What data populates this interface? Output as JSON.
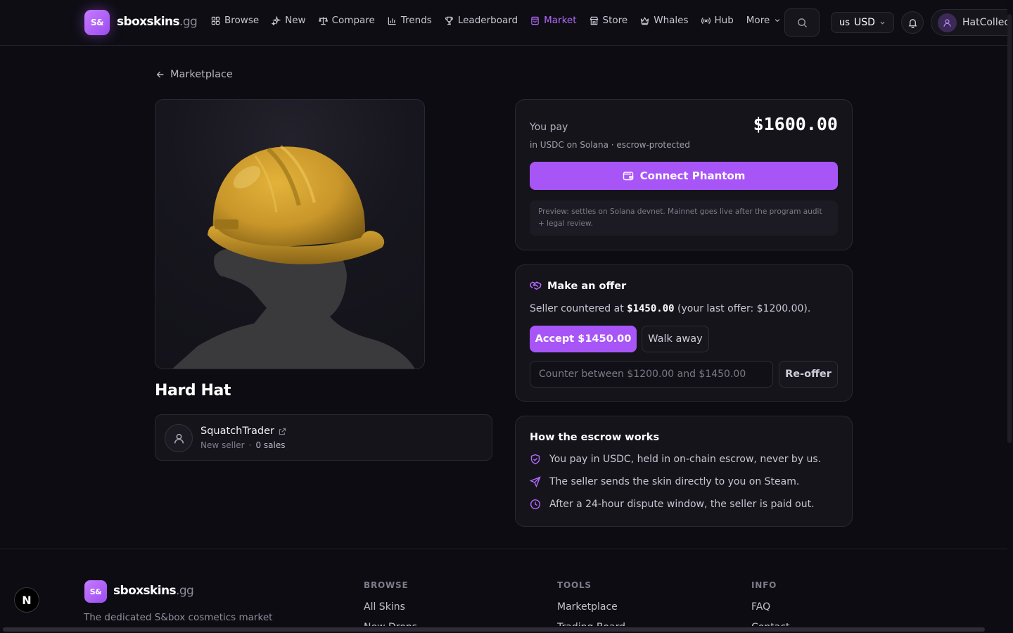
{
  "header": {
    "logo_text": "S&",
    "brand_name": "sboxskins",
    "brand_tld": ".gg",
    "nav": [
      {
        "label": "Browse",
        "icon": "grid-icon",
        "active": false
      },
      {
        "label": "New",
        "icon": "sparkle-icon",
        "active": false
      },
      {
        "label": "Compare",
        "icon": "scale-icon",
        "active": false
      },
      {
        "label": "Trends",
        "icon": "bar-chart-icon",
        "active": false
      },
      {
        "label": "Leaderboard",
        "icon": "trophy-icon",
        "active": false
      },
      {
        "label": "Market",
        "icon": "store-bag-icon",
        "active": true
      },
      {
        "label": "Store",
        "icon": "shop-icon",
        "active": false
      },
      {
        "label": "Whales",
        "icon": "crown-icon",
        "active": false
      },
      {
        "label": "Hub",
        "icon": "broadcast-icon",
        "active": false
      },
      {
        "label": "More",
        "icon": "chevron-down-icon",
        "active": false
      }
    ],
    "currency_flag": "us",
    "currency": "USD",
    "username": "HatCollector"
  },
  "breadcrumb": {
    "back_label": "Marketplace"
  },
  "item": {
    "name": "Hard Hat"
  },
  "seller": {
    "name": "SquatchTrader",
    "status": "New seller",
    "separator": "·",
    "sales": "0 sales"
  },
  "purchase": {
    "you_pay_label": "You pay",
    "price": "$1600.00",
    "subtitle": "in USDC on Solana · escrow-protected",
    "connect_label": "Connect Phantom",
    "notice": "Preview: settles on Solana devnet. Mainnet goes live after the program audit + legal review."
  },
  "offer": {
    "title": "Make an offer",
    "counter_prefix": "Seller countered at ",
    "counter_amount": "$1450.00",
    "counter_suffix": " (your last offer: $1200.00).",
    "accept_label": "Accept $1450.00",
    "walk_label": "Walk away",
    "input_placeholder": "Counter between $1200.00 and $1450.00",
    "reoffer_label": "Re-offer"
  },
  "escrow": {
    "title": "How the escrow works",
    "steps": [
      {
        "icon": "shield-check-icon",
        "text": "You pay in USDC, held in on-chain escrow, never by us."
      },
      {
        "icon": "send-icon",
        "text": "The seller sends the skin directly to you on Steam."
      },
      {
        "icon": "clock-icon",
        "text": "After a 24-hour dispute window, the seller is paid out."
      }
    ]
  },
  "footer": {
    "logo_text": "S&",
    "brand_name": "sboxskins",
    "brand_tld": ".gg",
    "tagline": "The dedicated S&box cosmetics market",
    "columns": [
      {
        "title": "BROWSE",
        "links": [
          "All Skins",
          "New Drops"
        ]
      },
      {
        "title": "TOOLS",
        "links": [
          "Marketplace",
          "Trading Board"
        ]
      },
      {
        "title": "INFO",
        "links": [
          "FAQ",
          "Contact"
        ]
      }
    ]
  },
  "dev_badge": "N",
  "colors": {
    "accent": "#a855f7",
    "background": "#0d0c12",
    "card": "#15141b"
  }
}
